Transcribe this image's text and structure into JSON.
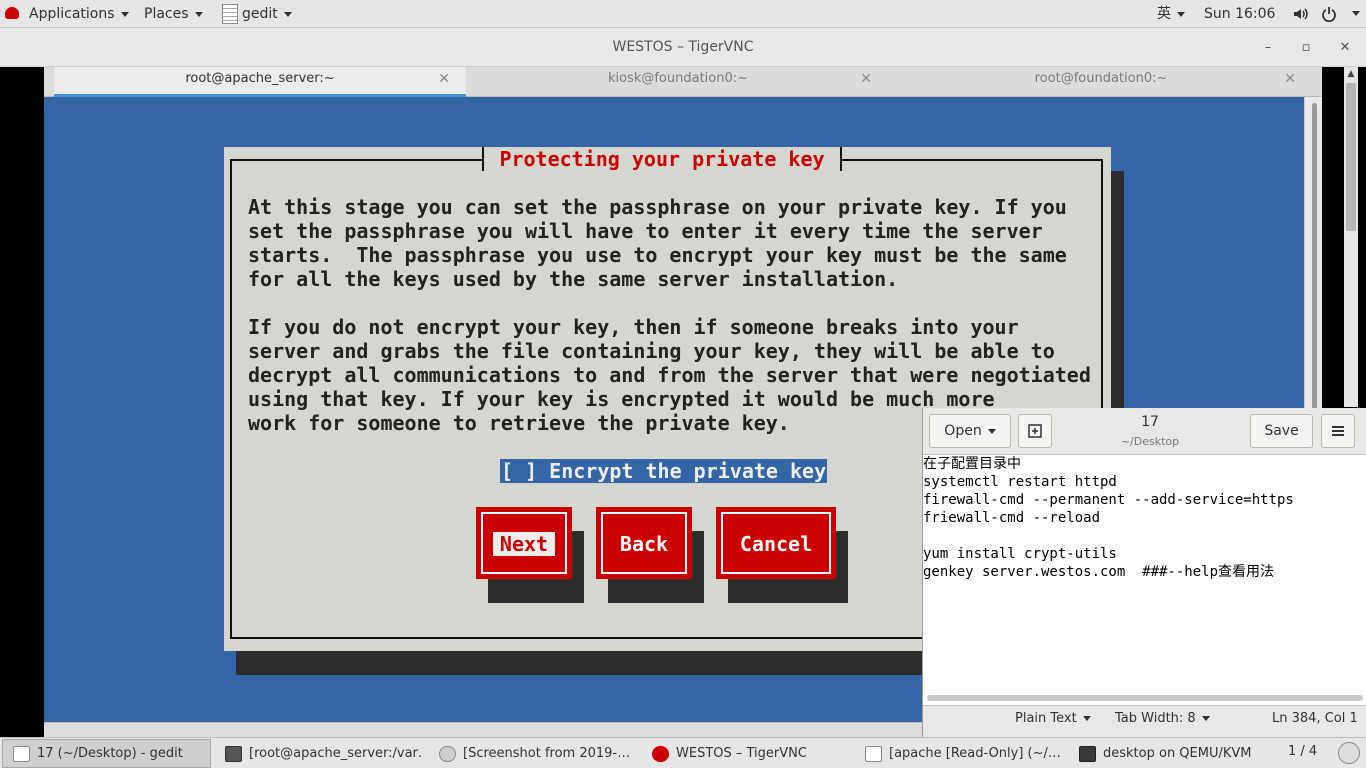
{
  "topbar": {
    "applications": "Applications",
    "places": "Places",
    "app": "gedit",
    "input_method": "英",
    "clock": "Sun 16:06"
  },
  "vnc": {
    "title": "WESTOS – TigerVNC"
  },
  "terminal": {
    "tabs": [
      {
        "label": "root@apache_server:~",
        "active": true
      },
      {
        "label": "kiosk@foundation0:~",
        "active": false
      },
      {
        "label": "root@foundation0:~",
        "active": false
      }
    ]
  },
  "dialog": {
    "title": "Protecting your private key",
    "paragraph1": [
      "At this stage you can set the passphrase on your private key. If you",
      "set the passphrase you will have to enter it every time the server",
      "starts.  The passphrase you use to encrypt your key must be the same",
      "for all the keys used by the same server installation."
    ],
    "paragraph2": [
      "If you do not encrypt your key, then if someone breaks into your",
      "server and grabs the file containing your key, they will be able to",
      "decrypt all communications to and from the server that were negotiated",
      "using that key. If your key is encrypted it would be much more",
      "work for someone to retrieve the private key."
    ],
    "checkbox": "[ ] Encrypt the private key",
    "buttons": {
      "next": "Next",
      "back": "Back",
      "cancel": "Cancel"
    }
  },
  "gedit": {
    "open_label": "Open",
    "save_label": "Save",
    "title": "17",
    "subtitle": "~/Desktop",
    "lines": [
      "在子配置目录中",
      "systemctl restart httpd",
      "firewall-cmd --permanent --add-service=https",
      "friewall-cmd --reload",
      "",
      "yum install crypt-utils",
      "genkey server.westos.com  ###--help查看用法"
    ],
    "status": {
      "language": "Plain Text",
      "tab_width": "Tab Width: 8",
      "position": "Ln 384, Col 1"
    }
  },
  "taskbar": {
    "items": [
      {
        "label": "17 (~/Desktop) - gedit",
        "active": true
      },
      {
        "label": "[root@apache_server:/var…",
        "active": false
      },
      {
        "label": "[Screenshot from 2019-…",
        "active": false
      },
      {
        "label": "WESTOS – TigerVNC",
        "active": false
      },
      {
        "label": "[apache [Read-Only] (~/…",
        "active": false
      },
      {
        "label": "desktop on QEMU/KVM",
        "active": false
      }
    ],
    "workspace": "1 / 4"
  },
  "colors": {
    "terminal_bg": "#3465a4",
    "dialog_bg": "#d3d7cf",
    "accent_red": "#cc0000",
    "tab_underline": "#4a90d9"
  }
}
